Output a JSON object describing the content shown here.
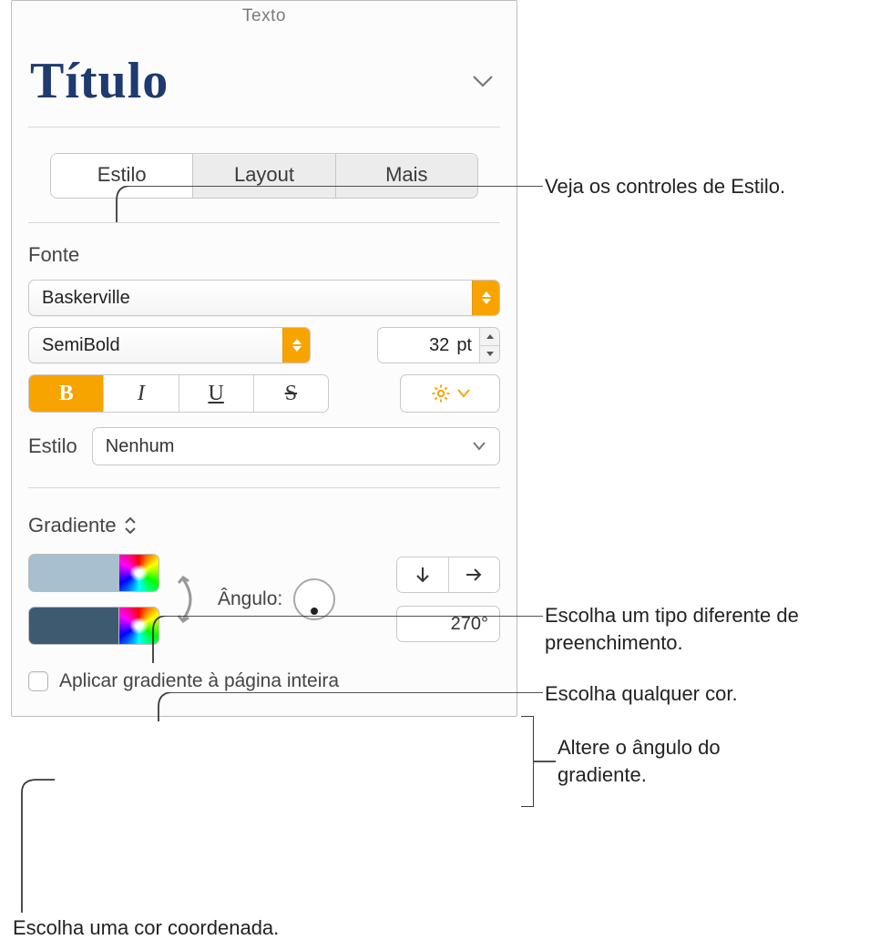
{
  "panel_title": "Texto",
  "paragraph_style": "Título",
  "tabs": {
    "style": "Estilo",
    "layout": "Layout",
    "more": "Mais"
  },
  "font": {
    "section_label": "Fonte",
    "family": "Baskerville",
    "weight": "SemiBold",
    "size_value": "32",
    "size_unit": "pt",
    "bold_glyph": "B",
    "italic_glyph": "I",
    "underline_glyph": "U",
    "strike_glyph": "S",
    "character_style_label": "Estilo",
    "character_style_value": "Nenhum"
  },
  "fill": {
    "type_label": "Gradiente",
    "angle_label": "Ângulo:",
    "angle_value": "270°",
    "swatch1_color": "#a7bfcf",
    "swatch2_color": "#3e5a71",
    "apply_whole_page": "Aplicar gradiente à página inteira"
  },
  "callouts": {
    "style_controls": "Veja os controles de Estilo.",
    "fill_type": "Escolha um tipo diferente de preenchimento.",
    "any_color": "Escolha qualquer cor.",
    "angle": "Altere o ângulo do gradiente.",
    "coord_color": "Escolha uma cor coordenada."
  }
}
